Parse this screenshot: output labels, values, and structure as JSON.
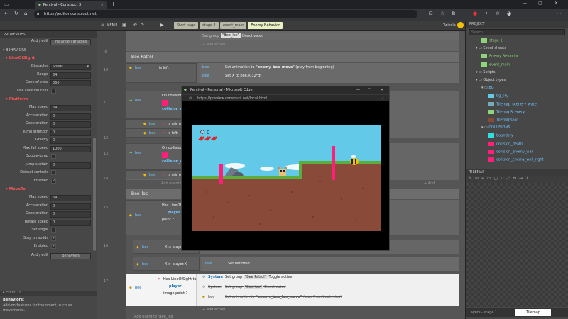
{
  "browser": {
    "tabs": [
      {
        "label": "Percival - Construct 3",
        "active": true
      }
    ],
    "new_tab_glyph": "+",
    "url": "https://editor.construct.net",
    "window_controls": [
      "—",
      "▢",
      "✕"
    ]
  },
  "toolbar": {
    "menu_label": "MENU",
    "layout_tabs": [
      {
        "label": "Start page",
        "active": false
      },
      {
        "label": "stage 1",
        "active": false
      },
      {
        "label": "event_main",
        "active": false
      },
      {
        "label": "Enemy Behavior",
        "active": true
      }
    ],
    "user": "Twiesla"
  },
  "properties": {
    "title": "PROPERTIES",
    "add_edit_label": "Add / edit",
    "instance_variables_btn": "Instance variables",
    "behaviors_header": "BEHAVIORS",
    "los_header": "LineOfSight",
    "los_rows": [
      {
        "label": "Obstacles",
        "value": "Solids"
      },
      {
        "label": "Range",
        "value": "64"
      },
      {
        "label": "Cone of view",
        "value": "360"
      },
      {
        "label": "Use collision cells",
        "value": ""
      }
    ],
    "platform_header": "Platform",
    "platform_rows": [
      {
        "label": "Max speed",
        "value": "64"
      },
      {
        "label": "Acceleration",
        "value": "0"
      },
      {
        "label": "Deceleration",
        "value": "0"
      },
      {
        "label": "Jump strength",
        "value": "0"
      },
      {
        "label": "Gravity",
        "value": "0"
      },
      {
        "label": "Max fall speed",
        "value": "1000"
      },
      {
        "label": "Double-jump",
        "value": ""
      },
      {
        "label": "Jump sustain",
        "value": "0"
      },
      {
        "label": "Default controls",
        "value": ""
      },
      {
        "label": "Enabled",
        "value": "✓"
      }
    ],
    "moveto_header": "MoveTo",
    "moveto_rows": [
      {
        "label": "Max speed",
        "value": "64"
      },
      {
        "label": "Acceleration",
        "value": "0"
      },
      {
        "label": "Deceleration",
        "value": "0"
      },
      {
        "label": "Rotate speed",
        "value": "0"
      },
      {
        "label": "Set angle",
        "value": ""
      },
      {
        "label": "Stop on solids",
        "value": "✓"
      },
      {
        "label": "Enabled",
        "value": "✓"
      }
    ],
    "add_edit_label2": "Add / edit",
    "behaviors_btn": "Behaviors",
    "effects_header": "EFFECTS",
    "help_title": "Behaviors:",
    "help_text": "Add-on features for the object, such as movements."
  },
  "sheet": {
    "top_group": {
      "obj": "",
      "pill": "\"Bee_los\"",
      "action": "Deactivated"
    },
    "add_action": "+ Add action",
    "bee_patrol": "Bee Patrol",
    "ev1": {
      "obj": "bee",
      "cond": "is left",
      "act1_obj": "bee",
      "act1_pre": "Set animation to ",
      "act1_b": "\"enemy_bee_move\"",
      "act1_post": " (play from beginning)",
      "act2_obj": "bee",
      "act2": "Set X to bee.X-32*dt"
    },
    "ev2": {
      "cond1": "On collision",
      "cond2": "collision_enemy_wall",
      "sub_obj": "bee",
      "sub": "Is mirrored",
      "sub2": "Is left"
    },
    "ev3": {
      "cond1": "On collision",
      "cond2": "collision_enemy_wall_right",
      "sub": "Is mirrored"
    },
    "add_event_patrol": "Add event to 'Bee Patrol'",
    "add_action2": "+ Add...",
    "bee_los": "Bee_los",
    "ev4": {
      "obj": "bee",
      "cond": "Has LineOfSight to",
      "target": "player",
      "point": "point ?"
    },
    "ev5": {
      "obj": "bee",
      "cond": "X ≤ player.X",
      "act_obj": "bee",
      "act": "Set Mirrored"
    },
    "ev6": {
      "obj": "bee",
      "cond": "X > player.X",
      "act_obj": "bee",
      "act": "Set Mirrored"
    },
    "ev7": {
      "obj": "bee",
      "cond": "Has LineOfSight to",
      "target": "player",
      "point": "image point ?",
      "a1_obj": "System",
      "a1_pre": "Set group ",
      "a1_pill": "\"Bee Patrol\"",
      "a1_post": " Toggle active",
      "a2_obj": "System",
      "a2_pre": "Set group ",
      "a2_pill": "\"Bee_los\"",
      "a2_post": " Deactivated",
      "a3_obj": "bee",
      "a3_pre": "Set animation to ",
      "a3_b": "\"enemy_bee_los_move\"",
      "a3_post": " (play from beginning)"
    },
    "add_event_los": "Add event to 'Bee_los'",
    "line_numbers": [
      "9",
      "10",
      "11",
      "12",
      "13",
      "14",
      "15",
      "16",
      "17"
    ]
  },
  "popup": {
    "title": "Percival - Personal - Microsoft Edge",
    "url": "https://preview.construct.net/local.html",
    "hud_count": "0"
  },
  "project": {
    "title": "PROJECT",
    "search_placeholder": "Search",
    "items": [
      {
        "label": "stage 1",
        "cls": "g",
        "indent": 22
      },
      {
        "label": "Event sheets",
        "cls": "",
        "indent": 14
      },
      {
        "label": "Enemy Behavior",
        "cls": "g",
        "indent": 22
      },
      {
        "label": "event_main",
        "cls": "g",
        "indent": 22
      },
      {
        "label": "Scripts",
        "cls": "",
        "indent": 14
      },
      {
        "label": "Object types",
        "cls": "",
        "indent": 14
      },
      {
        "label": "BG",
        "cls": "b",
        "indent": 22
      },
      {
        "label": "bg_sky",
        "cls": "b",
        "indent": 32
      },
      {
        "label": "Tilemap_scenery_water",
        "cls": "b",
        "indent": 32
      },
      {
        "label": "TilemapScenery",
        "cls": "b",
        "indent": 32
      },
      {
        "label": "Tilemapsolid",
        "cls": "b",
        "indent": 32
      },
      {
        "label": "COLLISIONS",
        "cls": "b",
        "indent": 22
      },
      {
        "label": "boundary",
        "cls": "b",
        "indent": 32
      },
      {
        "label": "collision_death",
        "cls": "b",
        "indent": 32
      },
      {
        "label": "collision_enemy_wall",
        "cls": "b",
        "indent": 32
      },
      {
        "label": "collision_enemy_wall_right",
        "cls": "b",
        "indent": 32
      }
    ],
    "tilemap_title": "TILEMAP",
    "bottom_tabs": [
      {
        "label": "Layers - stage 1",
        "active": false
      },
      {
        "label": "Tilemap",
        "active": true
      }
    ]
  },
  "colors": {
    "accent": "#8fd47a",
    "red_header": "#ee5555",
    "obj_blue": "#6fc5ff",
    "sky": "#62c9e8",
    "dirt": "#8a4a3a",
    "grass": "#5cae3a",
    "pink": "#ff1f7a"
  }
}
